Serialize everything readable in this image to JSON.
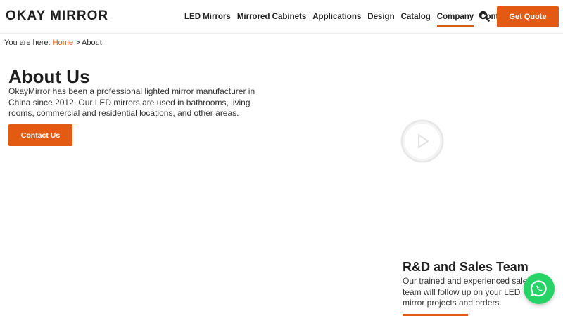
{
  "header": {
    "logo": "OKAY MIRROR",
    "nav": [
      "LED Mirrors",
      "Mirrored Cabinets",
      "Applications",
      "Design",
      "Catalog",
      "Company",
      "Contact"
    ],
    "active_nav": "Company",
    "search_icon": "search-icon",
    "quote_label": "Get Quote"
  },
  "breadcrumb": {
    "prefix": "You are here:",
    "home": "Home",
    "separator": ">",
    "current": "About"
  },
  "about": {
    "title": "About Us",
    "description": "OkayMirror has been a professional lighted mirror manufacturer in China since 2012. Our LED mirrors are used in bathrooms, living rooms, commercial and residential locations, and other areas.",
    "contact_label": "Contact Us"
  },
  "video": {
    "play_icon": "play-icon"
  },
  "rd_team": {
    "title": "R&D and Sales Team",
    "description": "Our trained and experienced sales team will follow up on your LED mirror projects and orders."
  },
  "floating": {
    "whatsapp_icon": "whatsapp-icon"
  },
  "colors": {
    "accent": "#e35a13",
    "whatsapp": "#25d366",
    "text": "#1e1e1e"
  }
}
